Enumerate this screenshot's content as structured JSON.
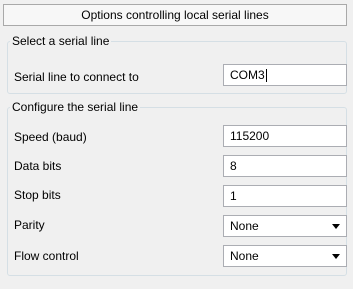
{
  "header": {
    "title": "Options controlling local serial lines"
  },
  "select_group": {
    "legend": "Select a serial line",
    "serial_line_label": "Serial line to connect to",
    "serial_line_value": "COM3"
  },
  "config_group": {
    "legend": "Configure the serial line",
    "speed_label": "Speed (baud)",
    "speed_value": "115200",
    "data_bits_label": "Data bits",
    "data_bits_value": "8",
    "stop_bits_label": "Stop bits",
    "stop_bits_value": "1",
    "parity_label": "Parity",
    "parity_value": "None",
    "flow_control_label": "Flow control",
    "flow_control_value": "None"
  },
  "icons": {
    "dropdown": "chevron-down-icon"
  }
}
